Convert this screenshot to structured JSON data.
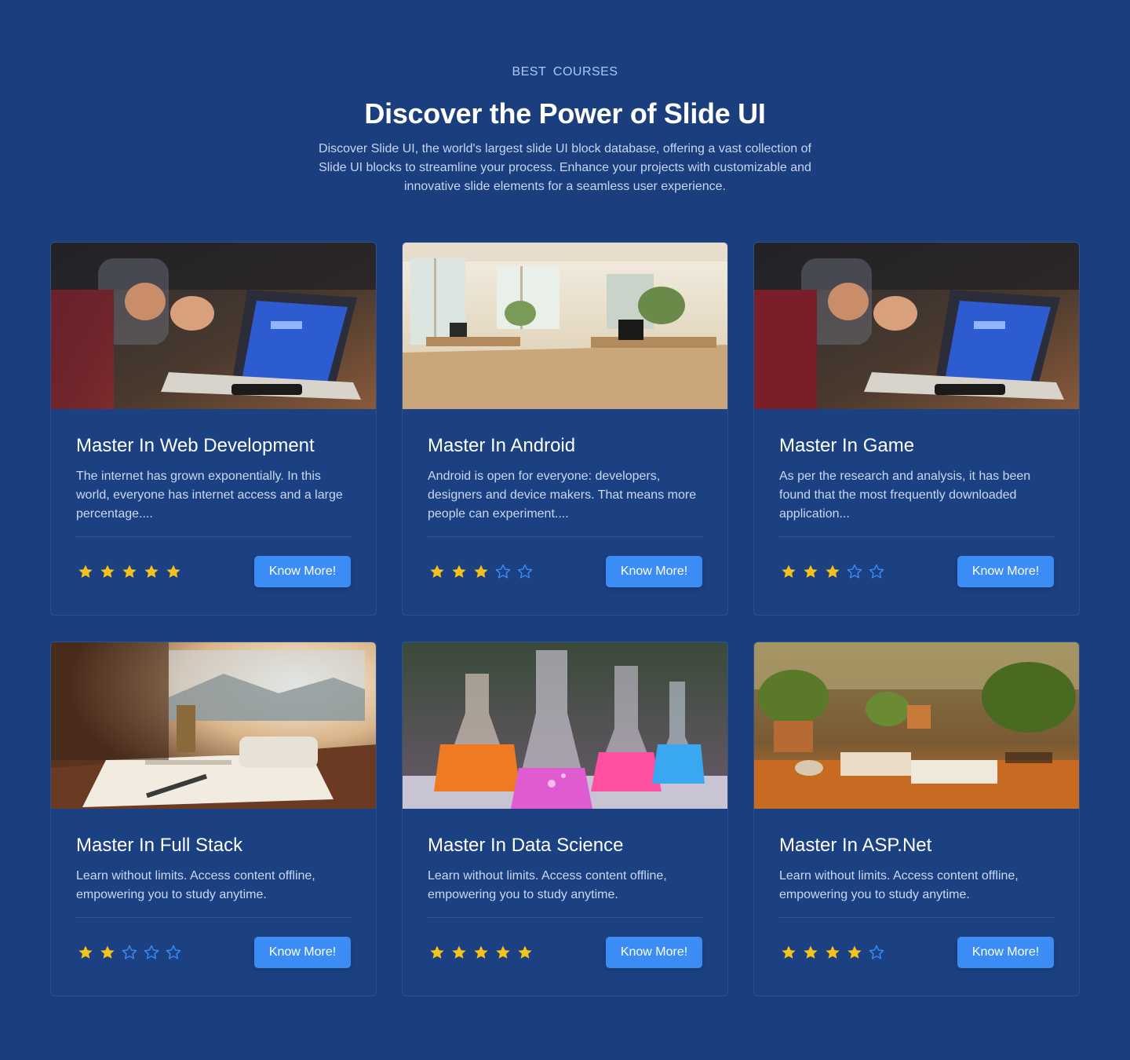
{
  "header": {
    "eyebrow": "BEST COURSES",
    "title": "Discover the Power of Slide UI",
    "subtitle": "Discover Slide UI, the world's largest slide UI block database, offering a vast collection of Slide UI blocks to streamline your process. Enhance your projects with customizable and innovative slide elements for a seamless user experience."
  },
  "colors": {
    "background": "#1b3f7e",
    "button": "#3b8cf5",
    "star_filled": "#f7c21b",
    "star_empty": "#3b8cf5"
  },
  "courses": [
    {
      "title": "Master In Web Development",
      "description": "The internet has grown exponentially. In this world, everyone has internet access and a large percentage....",
      "rating": 5,
      "button": "Know More!",
      "image": "laptop-workspace-photo"
    },
    {
      "title": "Master In Android",
      "description": "Android is open for everyone: developers, designers and device makers. That means more people can experiment....",
      "rating": 3,
      "button": "Know More!",
      "image": "bright-office-photo"
    },
    {
      "title": "Master In Game",
      "description": "As per the research and analysis, it has been found that the most frequently downloaded application...",
      "rating": 3,
      "button": "Know More!",
      "image": "laptop-workspace-photo"
    },
    {
      "title": "Master In Full Stack",
      "description": "Learn without limits. Access content offline, empowering you to study anytime.",
      "rating": 2,
      "button": "Know More!",
      "image": "desk-with-notebook-photo"
    },
    {
      "title": "Master In Data Science",
      "description": "Learn without limits. Access content offline, empowering you to study anytime.",
      "rating": 5,
      "button": "Know More!",
      "image": "lab-flasks-photo"
    },
    {
      "title": "Master In ASP.Net",
      "description": "Learn without limits. Access content offline, empowering you to study anytime.",
      "rating": 4,
      "button": "Know More!",
      "image": "plants-and-books-photo"
    }
  ]
}
